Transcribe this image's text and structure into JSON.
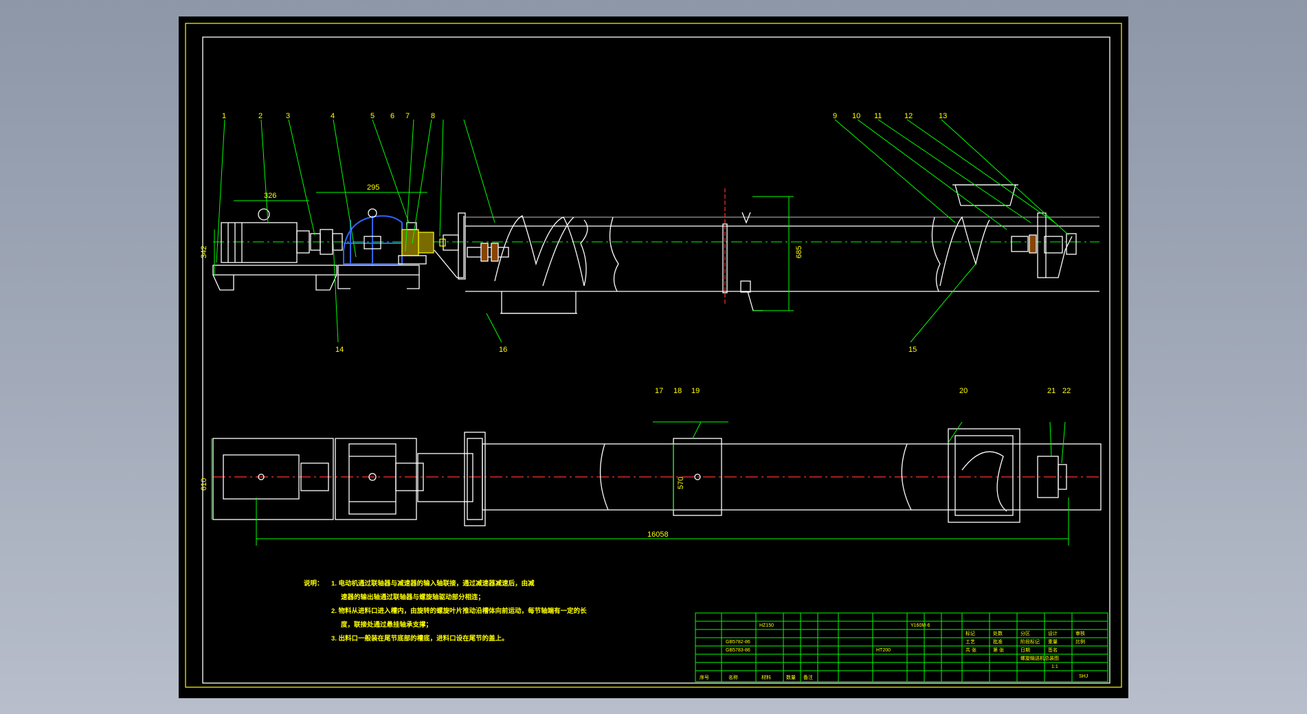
{
  "drawing": {
    "part_numbers": [
      "1",
      "2",
      "3",
      "4",
      "5",
      "6",
      "7",
      "8",
      "9",
      "10",
      "11",
      "12",
      "13",
      "14",
      "15",
      "16",
      "17",
      "18",
      "19",
      "20",
      "21",
      "22"
    ],
    "dimensions": {
      "motor_length": "326",
      "coupling_length": "295",
      "motor_height": "342",
      "trough_height": "685",
      "plan_width": "610",
      "trough_width": "570",
      "overall_length": "16058"
    },
    "notes": {
      "title": "说明：",
      "lines": [
        "1. 电动机通过联轴器与减速器的输入轴联接，通过减速器减速后，由减",
        "速器的输出轴通过联轴器与螺旋轴驱动部分相连；",
        "2. 物料从进料口进入槽内，由旋转的螺旋叶片推动沿槽体向前运动，每节轴端有一定的长",
        "度，联接处通过悬挂轴承支撑；",
        "3. 出料口一般装在尾节底部的槽底，进料口设在尾节的盖上。"
      ]
    },
    "title_block": {
      "drawing_title": "螺旋输送机总装图",
      "code": "SHJ",
      "scale": "1:1",
      "material": "HT200",
      "model": "Y160M-6",
      "reducer": "HZ150",
      "std1": "GB5782-86",
      "std2": "GB5783-86",
      "headers": [
        "序号",
        "名称",
        "材料",
        "数量",
        "备注"
      ],
      "cells": [
        "标记",
        "处数",
        "分区",
        "设计",
        "审核",
        "工艺",
        "批准",
        "阶段标记",
        "重量",
        "比例",
        "共 张",
        "第 张",
        "日期",
        "签名"
      ]
    }
  }
}
